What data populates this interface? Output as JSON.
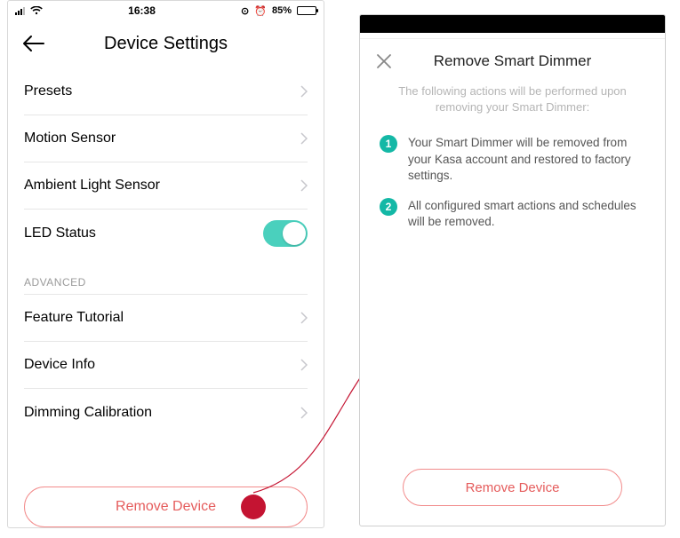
{
  "status_bar": {
    "time": "16:38",
    "battery_pct": "85%"
  },
  "settings": {
    "title": "Device Settings",
    "rows": {
      "presets": "Presets",
      "motion": "Motion Sensor",
      "ambient": "Ambient Light Sensor",
      "led": "LED Status",
      "tutorial": "Feature Tutorial",
      "device_info": "Device Info",
      "dimming": "Dimming Calibration"
    },
    "section_advanced": "ADVANCED",
    "remove_label": "Remove Device"
  },
  "modal": {
    "title": "Remove Smart Dimmer",
    "subtitle": "The following actions will be performed upon removing your Smart Dimmer:",
    "items": [
      "Your Smart Dimmer will be removed from your Kasa account and restored to factory settings.",
      "All configured smart actions and schedules will be removed."
    ],
    "remove_label": "Remove Device"
  }
}
